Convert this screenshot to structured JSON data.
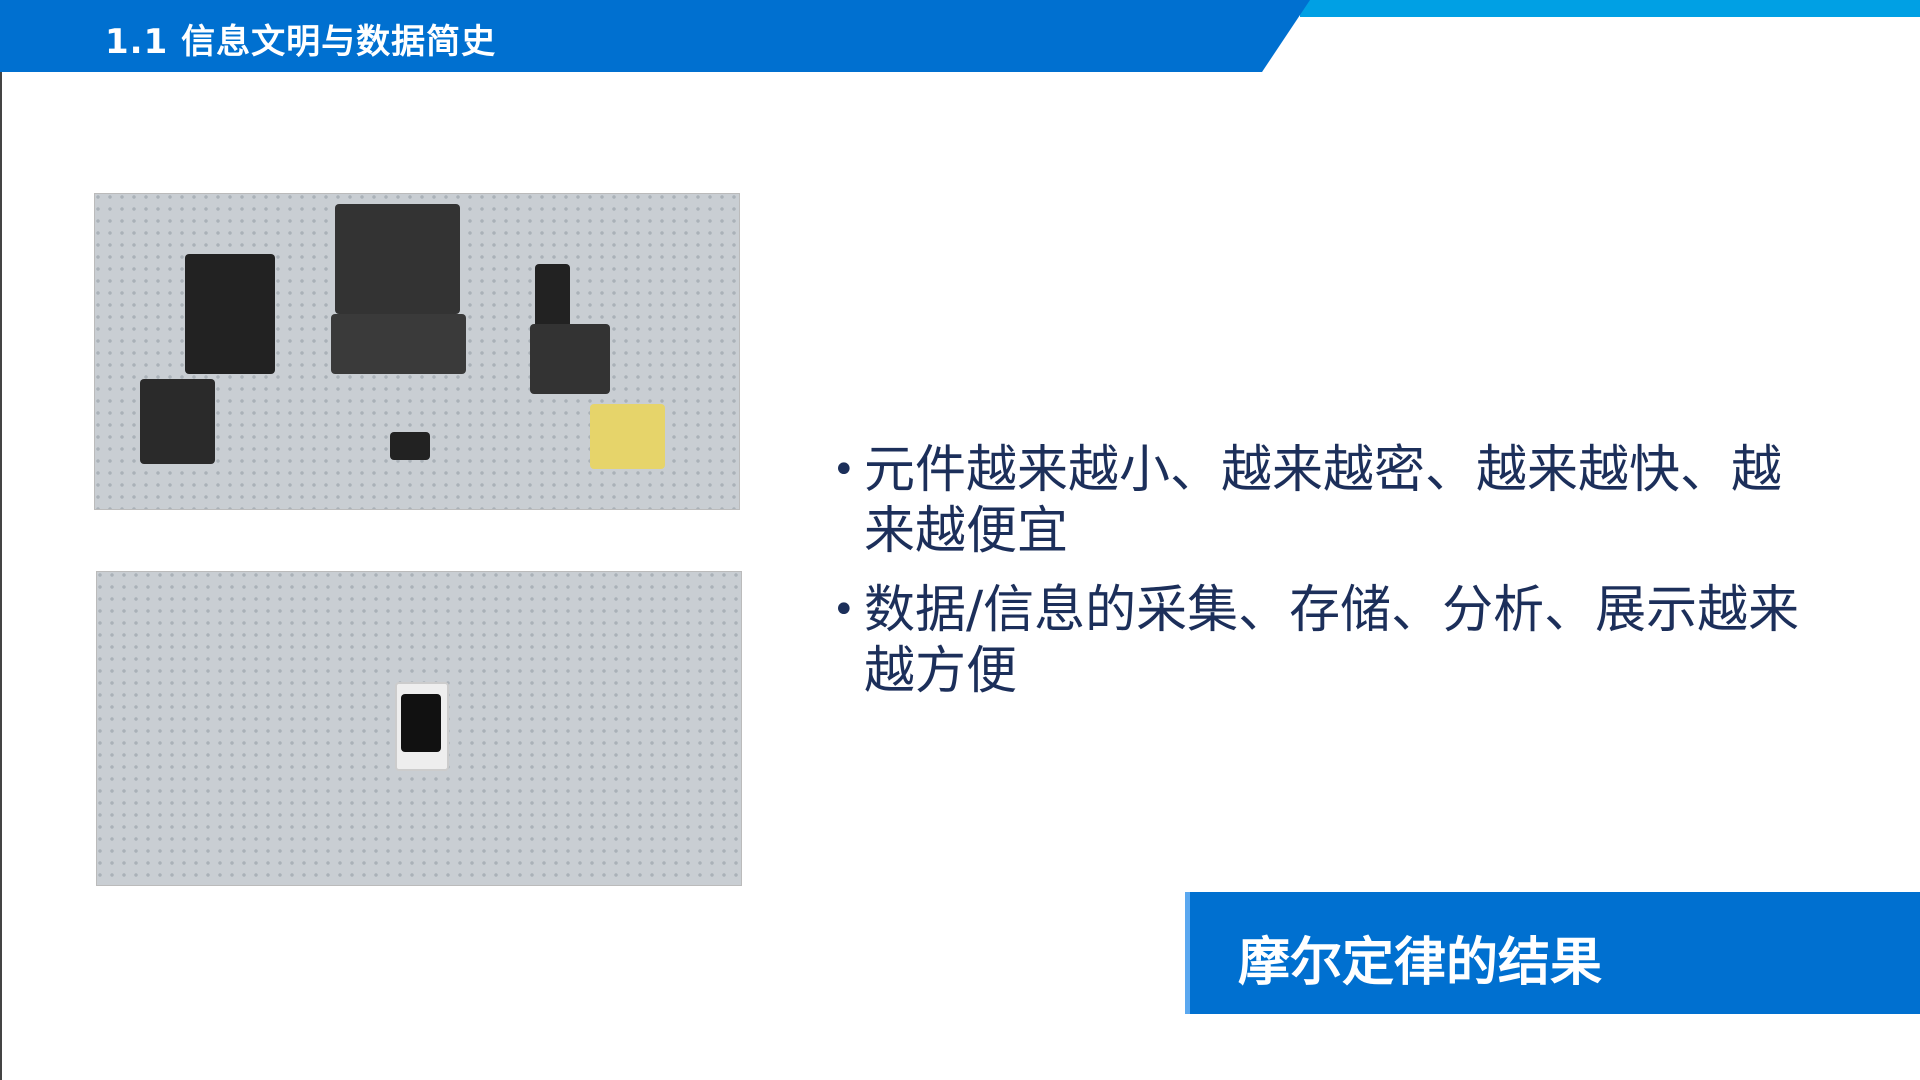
{
  "header": {
    "title": "1.1  信息文明与数据简史",
    "color": "#0070d0",
    "strip_color": "#00a0e4"
  },
  "images": [
    {
      "description_icon": "old-devices-photo"
    },
    {
      "description_icon": "smartphone-photo"
    }
  ],
  "bullets": [
    "元件越来越小、越来越密、越来越快、越来越便宜",
    "数据/信息的采集、存储、分析、展示越来越方便"
  ],
  "result_box": {
    "label": "摩尔定律的结果",
    "color": "#0070d0"
  }
}
